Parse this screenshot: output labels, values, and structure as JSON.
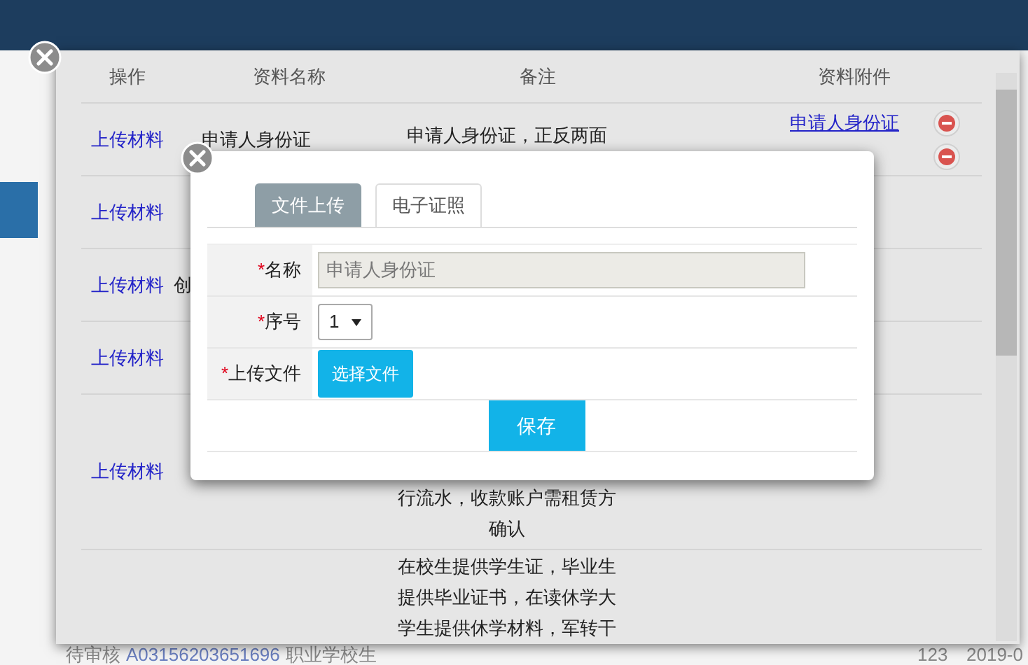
{
  "background_row": {
    "status": "待审核",
    "code": "A03156203651696",
    "type": "职业学校生",
    "count": "123",
    "date": "2019-0"
  },
  "outer_dialog": {
    "columns": [
      "操作",
      "资料名称",
      "备注",
      "资料附件"
    ],
    "rows": [
      {
        "action": "上传材料",
        "name": "申请人身份证",
        "remark": [
          "申请人身份证，正反两面"
        ],
        "attachments": [
          {
            "name": "申请人身份证",
            "removable": true
          },
          {
            "removable": true
          }
        ]
      },
      {
        "action": "上传材料",
        "name": "",
        "remark": [],
        "attachments": []
      },
      {
        "action": "上传材料",
        "name": "创",
        "remark": [],
        "attachments": []
      },
      {
        "action": "上传材料",
        "name": "",
        "remark": [],
        "attachments": []
      },
      {
        "action": "上传材料",
        "name": "",
        "remark": [
          "行流水，收款账户需租赁方",
          "确认"
        ],
        "attachments": []
      },
      {
        "action": "",
        "name": "",
        "remark": [
          "在校生提供学生证，毕业生",
          "提供毕业证书，在读休学大",
          "学生提供休学材料，军转干"
        ],
        "attachments": []
      }
    ]
  },
  "upload_dialog": {
    "tabs": [
      {
        "label": "文件上传",
        "selected": true
      },
      {
        "label": "电子证照",
        "selected": false
      }
    ],
    "fields": [
      {
        "kind": "text",
        "marker": "*",
        "label": "名称",
        "value": "申请人身份证",
        "disabled": true
      },
      {
        "kind": "select",
        "marker": "*",
        "label": "序号",
        "value": "1"
      },
      {
        "kind": "file",
        "marker": "*",
        "label": "上传文件",
        "button": "选择文件"
      }
    ],
    "save": "保存"
  }
}
